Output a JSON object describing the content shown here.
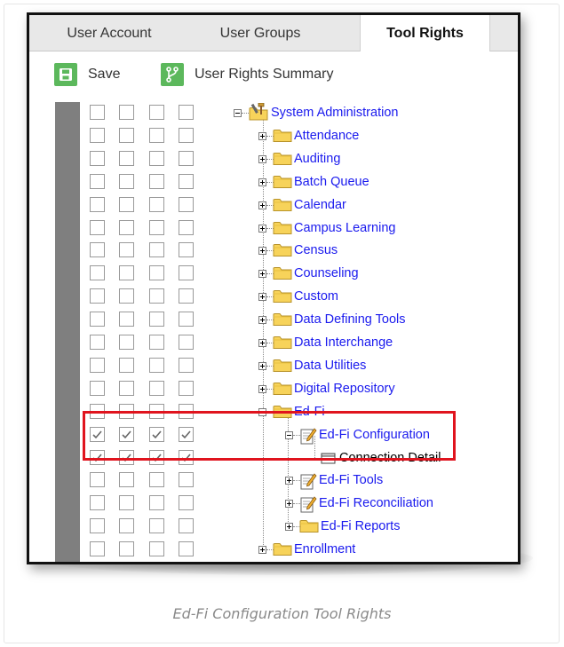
{
  "tabs": [
    {
      "label": "User Account",
      "active": false
    },
    {
      "label": "User Groups",
      "active": false
    },
    {
      "label": "Tool Rights",
      "active": true
    }
  ],
  "toolbar": {
    "save_label": "Save",
    "summary_label": "User Rights Summary",
    "save_icon": "floppy-disk-icon",
    "summary_icon": "branch-icon",
    "icon_color": "#5cb85c"
  },
  "tree": [
    {
      "label": "System Administration",
      "level": 0,
      "icon": "tools-folder-icon",
      "expander": "minus",
      "checks": [
        false,
        false,
        false,
        false
      ]
    },
    {
      "label": "Attendance",
      "level": 1,
      "icon": "folder-icon",
      "expander": "plus",
      "checks": [
        false,
        false,
        false,
        false
      ]
    },
    {
      "label": "Auditing",
      "level": 1,
      "icon": "folder-icon",
      "expander": "plus",
      "checks": [
        false,
        false,
        false,
        false
      ]
    },
    {
      "label": "Batch Queue",
      "level": 1,
      "icon": "folder-icon",
      "expander": "plus",
      "checks": [
        false,
        false,
        false,
        false
      ]
    },
    {
      "label": "Calendar",
      "level": 1,
      "icon": "folder-icon",
      "expander": "plus",
      "checks": [
        false,
        false,
        false,
        false
      ]
    },
    {
      "label": "Campus Learning",
      "level": 1,
      "icon": "folder-icon",
      "expander": "plus",
      "checks": [
        false,
        false,
        false,
        false
      ]
    },
    {
      "label": "Census",
      "level": 1,
      "icon": "folder-icon",
      "expander": "plus",
      "checks": [
        false,
        false,
        false,
        false
      ]
    },
    {
      "label": "Counseling",
      "level": 1,
      "icon": "folder-icon",
      "expander": "plus",
      "checks": [
        false,
        false,
        false,
        false
      ]
    },
    {
      "label": "Custom",
      "level": 1,
      "icon": "folder-icon",
      "expander": "plus",
      "checks": [
        false,
        false,
        false,
        false
      ]
    },
    {
      "label": "Data Defining Tools",
      "level": 1,
      "icon": "folder-icon",
      "expander": "plus",
      "checks": [
        false,
        false,
        false,
        false
      ]
    },
    {
      "label": "Data Interchange",
      "level": 1,
      "icon": "folder-icon",
      "expander": "plus",
      "checks": [
        false,
        false,
        false,
        false
      ]
    },
    {
      "label": "Data Utilities",
      "level": 1,
      "icon": "folder-icon",
      "expander": "plus",
      "checks": [
        false,
        false,
        false,
        false
      ]
    },
    {
      "label": "Digital Repository",
      "level": 1,
      "icon": "folder-icon",
      "expander": "plus",
      "checks": [
        false,
        false,
        false,
        false
      ]
    },
    {
      "label": "Ed-Fi",
      "level": 1,
      "icon": "folder-icon",
      "expander": "minus",
      "checks": [
        false,
        false,
        false,
        false
      ]
    },
    {
      "label": "Ed-Fi Configuration",
      "level": 2,
      "icon": "edit-page-icon",
      "expander": "minus",
      "checks": [
        true,
        true,
        true,
        true
      ]
    },
    {
      "label": "Connection Detail",
      "level": 3,
      "icon": "window-icon",
      "expander": "none",
      "checks": [
        true,
        true,
        true,
        true
      ]
    },
    {
      "label": "Ed-Fi Tools",
      "level": 2,
      "icon": "edit-page-icon",
      "expander": "plus",
      "checks": [
        false,
        false,
        false,
        false
      ]
    },
    {
      "label": "Ed-Fi Reconciliation",
      "level": 2,
      "icon": "edit-page-icon",
      "expander": "plus",
      "checks": [
        false,
        false,
        false,
        false
      ]
    },
    {
      "label": "Ed-Fi Reports",
      "level": 2,
      "icon": "folder-icon",
      "expander": "plus",
      "checks": [
        false,
        false,
        false,
        false
      ]
    },
    {
      "label": "Enrollment",
      "level": 1,
      "icon": "folder-icon",
      "expander": "plus",
      "checks": [
        false,
        false,
        false,
        false
      ]
    },
    {
      "label": "",
      "level": 1,
      "icon": "folder-icon",
      "expander": "plus",
      "checks": [
        false,
        false,
        false,
        false
      ]
    }
  ],
  "caption": "Ed-Fi Configuration Tool Rights",
  "highlight_color": "#e0141e"
}
